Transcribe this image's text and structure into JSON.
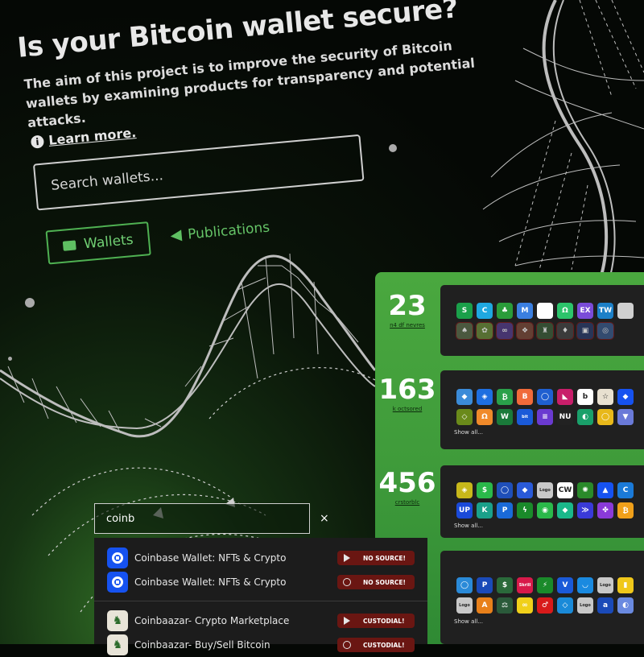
{
  "hero": {
    "title": "Is your Bitcoin wallet secure?",
    "lead": "The aim of this project is to improve the security of Bitcoin wallets by examining products for transparency and potential attacks.",
    "learn_more": "Learn more.",
    "search_placeholder": "Search wallets...",
    "nav": {
      "wallets": "Wallets",
      "publications": "Publications"
    }
  },
  "stats": [
    {
      "number": "23",
      "label": "n4 df nevres",
      "show_all": ""
    },
    {
      "number": "163",
      "label": "k octsored",
      "show_all": "Show all..."
    },
    {
      "number": "456",
      "label": "crstorblc",
      "show_all": "Show all..."
    },
    {
      "number": "",
      "label": "",
      "show_all": "Show all..."
    }
  ],
  "quick_search": {
    "value": "coinb",
    "close": "×"
  },
  "results": [
    {
      "name": "Coinbase Wallet: NFTs & Crypto",
      "badge": "NO SOURCE!",
      "platform": "play",
      "logo_color": "#1652f0"
    },
    {
      "name": "Coinbase Wallet: NFTs & Crypto",
      "badge": "NO SOURCE!",
      "platform": "apple",
      "logo_color": "#1652f0"
    },
    {
      "name": "Coinbaazar- Crypto Marketplace",
      "badge": "CUSTODIAL!",
      "platform": "play",
      "logo_color": "#e8e4d8"
    },
    {
      "name": "Coinbaazar- Buy/Sell Bitcoin",
      "badge": "CUSTODIAL!",
      "platform": "apple",
      "logo_color": "#e8e4d8"
    }
  ],
  "icon_rows": [
    [
      [
        "#1aa04a",
        "S"
      ],
      [
        "#1fa8e0",
        "C"
      ],
      [
        "#2a9c3a",
        "♣"
      ],
      [
        "#3b7fe0",
        "M"
      ],
      [
        "#ffffff",
        ""
      ],
      [
        "#2cc46b",
        "Ω"
      ],
      [
        "#7a4bd8",
        "EX"
      ],
      [
        "#1c80c8",
        "TW"
      ],
      [
        "#d0d0d0",
        ""
      ]
    ],
    [
      [
        "#5a6b4a",
        "♠"
      ],
      [
        "#6a8a3a",
        "✿"
      ],
      [
        "#553d8a",
        "∞"
      ],
      [
        "#7a4a3a",
        "❖"
      ],
      [
        "#3c5c3a",
        "♜"
      ],
      [
        "#444",
        "♦"
      ],
      [
        "#2b3d6a",
        "▣"
      ],
      [
        "#3a5a8a",
        "◎"
      ]
    ],
    [
      [
        "#3b8bd8",
        "◆"
      ],
      [
        "#1e6fe0",
        "◈"
      ],
      [
        "#2aa04a",
        "₿"
      ],
      [
        "#f06a3a",
        "B"
      ],
      [
        "#1f5fd0",
        "◯"
      ],
      [
        "#c81e6a",
        "◣"
      ],
      [
        "#ffffff",
        "b"
      ],
      [
        "#e8e0d0",
        "☆"
      ],
      [
        "#1652f0",
        "◆"
      ]
    ],
    [
      [
        "#6a8a1a",
        "◇"
      ],
      [
        "#f08a2a",
        "Ω"
      ],
      [
        "#1a7a3a",
        "W"
      ],
      [
        "#1a5ad8",
        "bit"
      ],
      [
        "#6a3ad0",
        "≡"
      ],
      [
        "#222",
        "NU"
      ],
      [
        "#1aa06a",
        "◐"
      ],
      [
        "#e8b81a",
        "◯"
      ],
      [
        "#6a7ad8",
        "▼"
      ]
    ],
    [
      [
        "#c8b81a",
        "◈"
      ],
      [
        "#2ab84a",
        "$"
      ],
      [
        "#1f4fb8",
        "◯"
      ],
      [
        "#2a5ad8",
        "◆"
      ],
      [
        "#c8c8c8",
        "Logo"
      ],
      [
        "#ffffff",
        "CW"
      ],
      [
        "#2a8a2a",
        "✺"
      ],
      [
        "#1652f0",
        "▲"
      ],
      [
        "#1a7ad8",
        "C"
      ]
    ],
    [
      [
        "#1a4ad8",
        "UP"
      ],
      [
        "#1aa08a",
        "K"
      ],
      [
        "#1a6ad8",
        "P"
      ],
      [
        "#1a8a2a",
        "ϟ"
      ],
      [
        "#2ab84a",
        "◉"
      ],
      [
        "#1ab88a",
        "◆"
      ],
      [
        "#3a3ad8",
        "≫"
      ],
      [
        "#8a3ad8",
        "✤"
      ],
      [
        "#f0a01a",
        "₿"
      ]
    ],
    [
      [
        "#2a8ad8",
        "◯"
      ],
      [
        "#1a4ab8",
        "P"
      ],
      [
        "#2a6a3a",
        "$"
      ],
      [
        "#d81a4a",
        "Skrill"
      ],
      [
        "#1a8a2a",
        "⚡"
      ],
      [
        "#1a5ad8",
        "V"
      ],
      [
        "#1a8ae0",
        "◡"
      ],
      [
        "#c8c8c8",
        "Logo"
      ],
      [
        "#f0c81a",
        "▮"
      ]
    ],
    [
      [
        "#c8c8c8",
        "Logo"
      ],
      [
        "#e8801a",
        "A"
      ],
      [
        "#2a5a3a",
        "⚖"
      ],
      [
        "#f0d01a",
        "∞"
      ],
      [
        "#d81a1a",
        "♂"
      ],
      [
        "#1a8ad8",
        "◇"
      ],
      [
        "#c8c8c8",
        "Logo"
      ],
      [
        "#1a4ab8",
        "a"
      ],
      [
        "#6a8ae0",
        "◐"
      ]
    ]
  ]
}
